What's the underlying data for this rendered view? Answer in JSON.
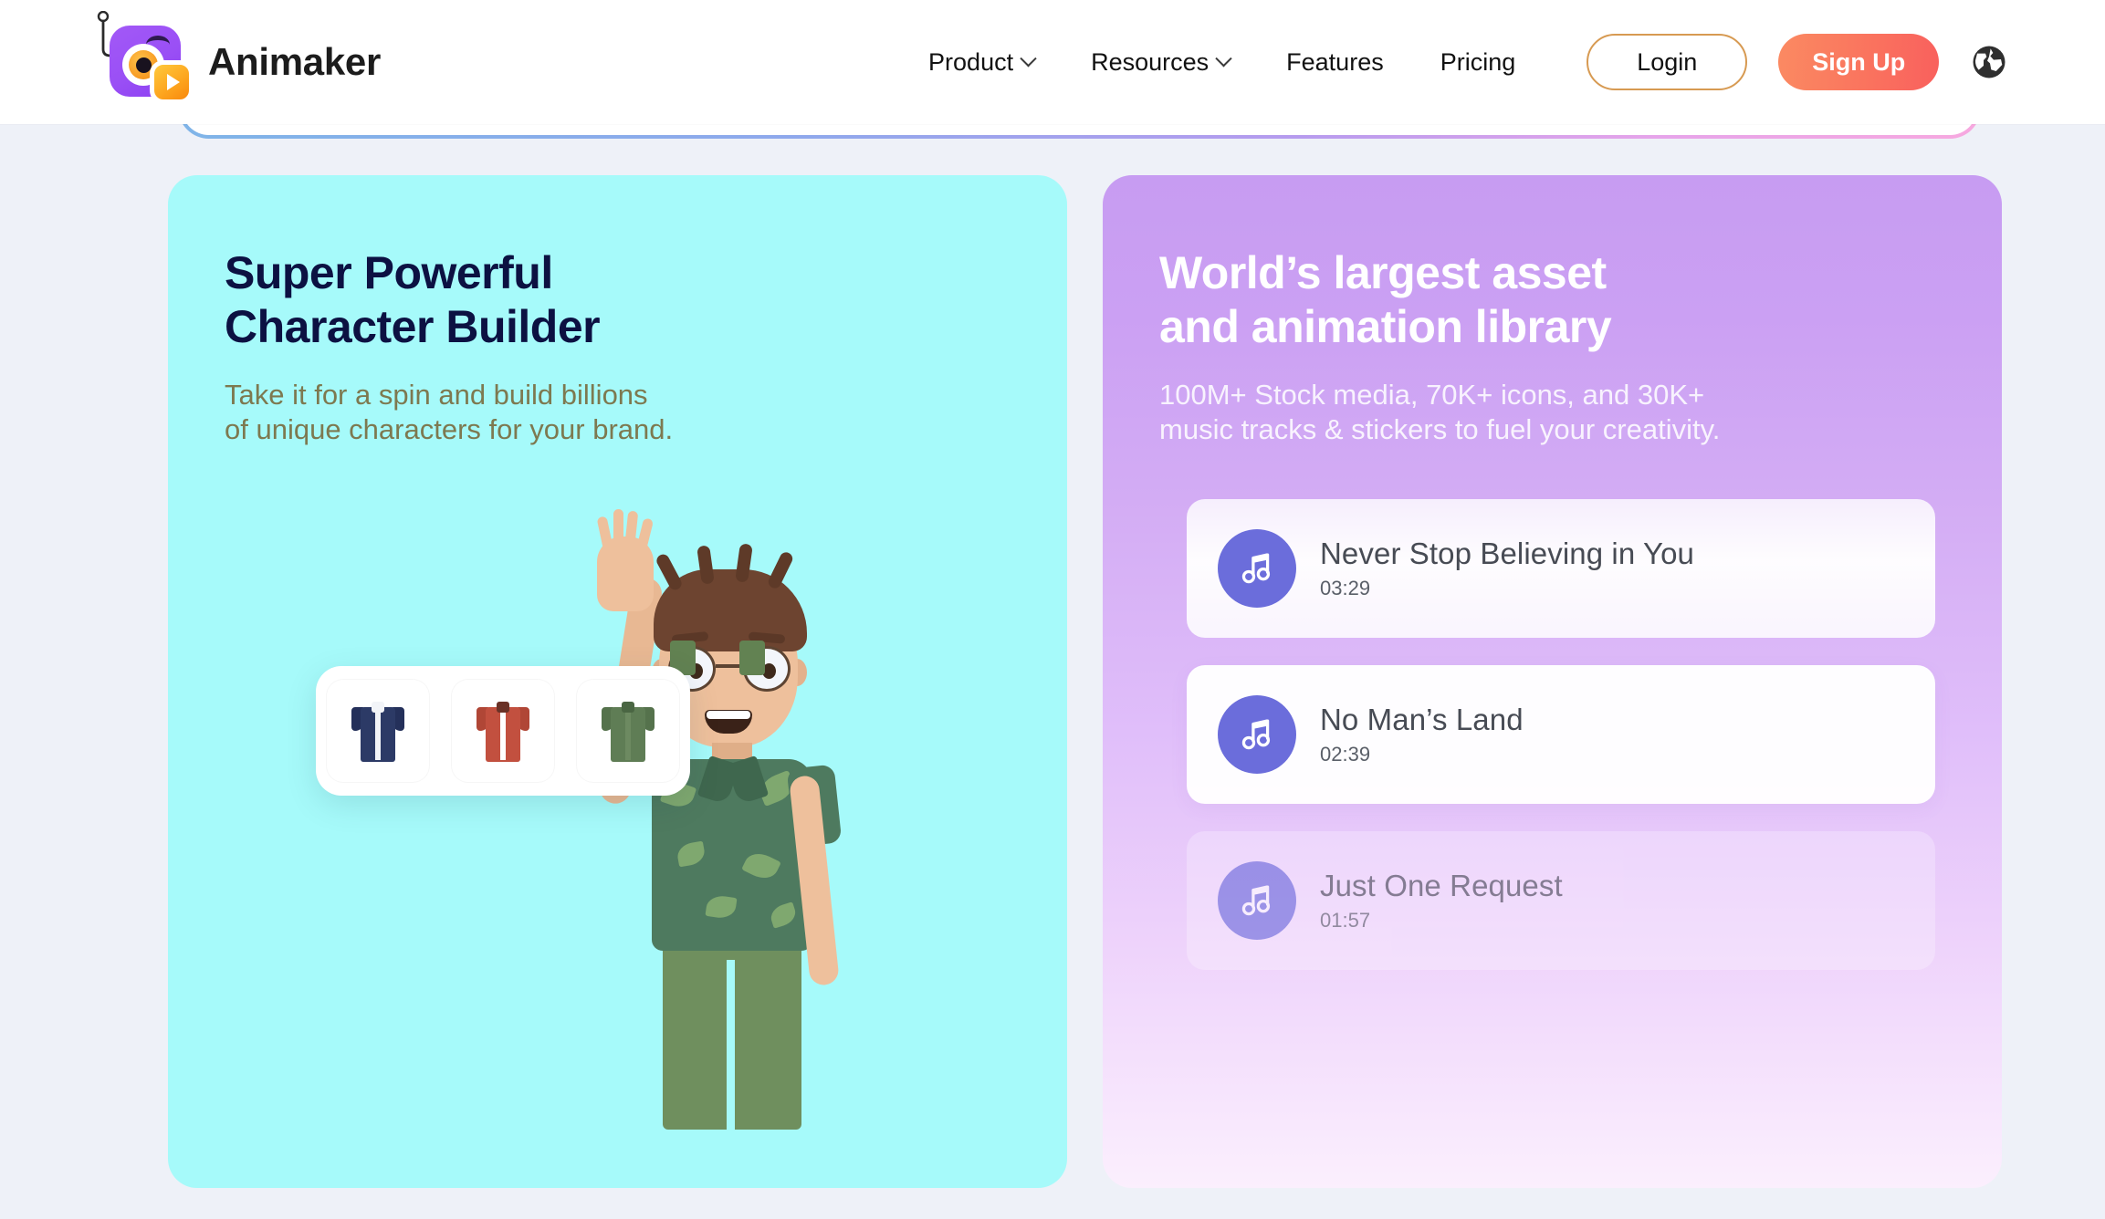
{
  "header": {
    "logo": {
      "icon_name": "animaker-logo-icon",
      "brand": "Animaker"
    },
    "nav": [
      {
        "label": "Product",
        "has_dropdown": true,
        "icon": "chevron-down-icon"
      },
      {
        "label": "Resources",
        "has_dropdown": true,
        "icon": "chevron-down-icon"
      },
      {
        "label": "Features",
        "has_dropdown": false,
        "icon": ""
      },
      {
        "label": "Pricing",
        "has_dropdown": false,
        "icon": ""
      }
    ],
    "login_label": "Login",
    "signup_label": "Sign Up",
    "language_icon": "globe-icon"
  },
  "colors": {
    "page_background": "#eef1f8",
    "header_background": "#ffffff",
    "card_left_background": "#a6fafa",
    "card_right_gradient_top": "#c79cf2",
    "card_right_gradient_bottom": "#fbeffd",
    "signup_gradient_start": "#fb8a62",
    "signup_gradient_end": "#f9605d",
    "login_border": "#d79a52",
    "heading_dark": "#0c1142",
    "subtitle_olive": "#7d7950",
    "music_icon_purple": "#6b6ddb",
    "logo_purple": "#9a4ff5",
    "logo_orange": "#fda41d"
  },
  "cards": {
    "left": {
      "title": "Super Powerful\nCharacter Builder",
      "subtitle": "Take it for a spin and build billions\nof unique characters for your brand.",
      "illustration_name": "waving-bearded-character-illustration",
      "outfit_picker": [
        {
          "name": "navy-blazer-thumbnail",
          "body": "#2c3a66",
          "sleeve": "#24305a",
          "collar": "#f2f4f8",
          "placket": "#ffffff"
        },
        {
          "name": "red-shirt-thumbnail",
          "body": "#c2503f",
          "sleeve": "#b04636",
          "collar": "#6a3126",
          "placket": "#ffffff"
        },
        {
          "name": "green-shirt-thumbnail",
          "body": "#5f7d55",
          "sleeve": "#55724c",
          "collar": "#4a6643",
          "placket": "#6d8a61"
        }
      ]
    },
    "right": {
      "title": "World’s largest asset\nand animation library",
      "subtitle": "100M+ Stock media, 70K+ icons, and 30K+\nmusic tracks & stickers to fuel your creativity.",
      "tracks": [
        {
          "title": "Never Stop Believing in You",
          "duration": "03:29",
          "icon": "music-note-icon"
        },
        {
          "title": "No Man’s Land",
          "duration": "02:39",
          "icon": "music-note-icon"
        },
        {
          "title": "Just One Request",
          "duration": "01:57",
          "icon": "music-note-icon"
        }
      ]
    }
  }
}
